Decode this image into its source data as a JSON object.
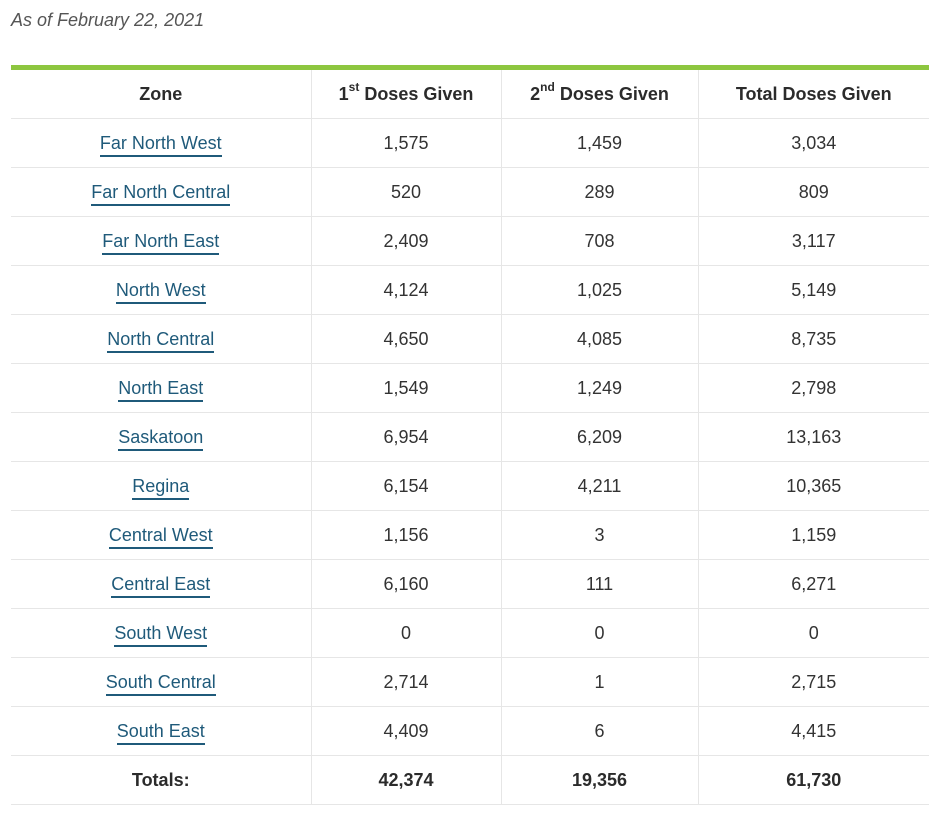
{
  "as_of": "As of February 22, 2021",
  "colors": {
    "accent_bar": "#8dc63f",
    "link": "#1f5a7a"
  },
  "table": {
    "headers": {
      "zone": "Zone",
      "first_num": "1",
      "first_sup": "st",
      "first_rest": " Doses Given",
      "second_num": "2",
      "second_sup": "nd",
      "second_rest": " Doses Given",
      "total": "Total Doses Given"
    },
    "rows": [
      {
        "zone": "Far North West",
        "first": "1,575",
        "second": "1,459",
        "total": "3,034"
      },
      {
        "zone": "Far North Central",
        "first": "520",
        "second": "289",
        "total": "809"
      },
      {
        "zone": "Far North East",
        "first": "2,409",
        "second": "708",
        "total": "3,117"
      },
      {
        "zone": "North West",
        "first": "4,124",
        "second": "1,025",
        "total": "5,149"
      },
      {
        "zone": "North Central",
        "first": "4,650",
        "second": "4,085",
        "total": "8,735"
      },
      {
        "zone": "North East",
        "first": "1,549",
        "second": "1,249",
        "total": "2,798"
      },
      {
        "zone": "Saskatoon",
        "first": "6,954",
        "second": "6,209",
        "total": "13,163"
      },
      {
        "zone": "Regina",
        "first": "6,154",
        "second": "4,211",
        "total": "10,365"
      },
      {
        "zone": "Central West",
        "first": "1,156",
        "second": "3",
        "total": "1,159"
      },
      {
        "zone": "Central East",
        "first": "6,160",
        "second": "111",
        "total": "6,271"
      },
      {
        "zone": "South West",
        "first": "0",
        "second": "0",
        "total": "0"
      },
      {
        "zone": "South Central",
        "first": "2,714",
        "second": "1",
        "total": "2,715"
      },
      {
        "zone": "South East",
        "first": "4,409",
        "second": "6",
        "total": "4,415"
      }
    ],
    "totals": {
      "label": "Totals:",
      "first": "42,374",
      "second": "19,356",
      "total": "61,730"
    }
  }
}
